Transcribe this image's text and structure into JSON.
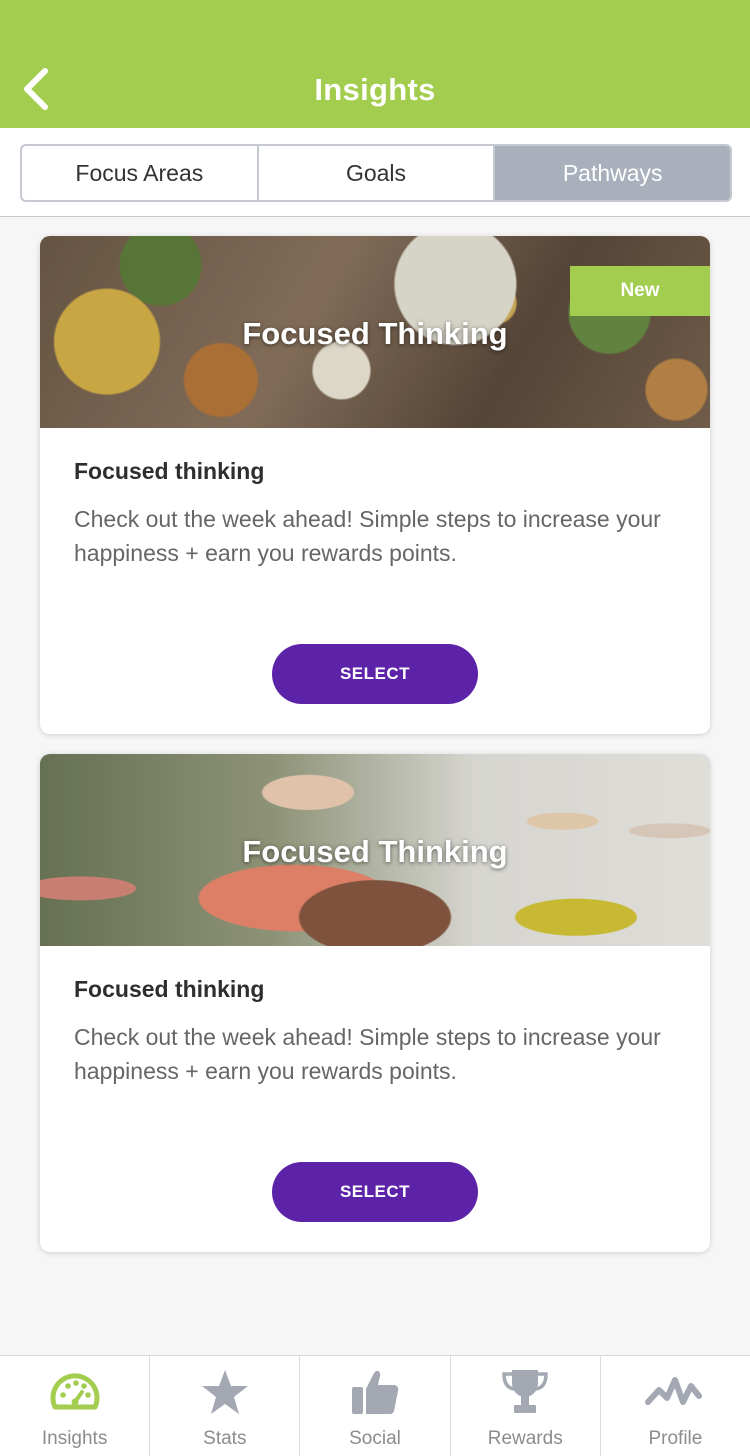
{
  "header": {
    "title": "Insights",
    "back_icon": "chevron-left-icon"
  },
  "tabs": {
    "items": [
      {
        "label": "Focus Areas"
      },
      {
        "label": "Goals"
      },
      {
        "label": "Pathways"
      }
    ],
    "active": "Pathways"
  },
  "cards": [
    {
      "image_caption": "Focused Thinking",
      "badge": "New",
      "title": "Focused thinking",
      "description": "Check out the week ahead! Simple steps to increase your happiness + earn you rewards points.",
      "button": "SELECT"
    },
    {
      "image_caption": "Focused Thinking",
      "title": "Focused thinking",
      "description": "Check out the week ahead! Simple steps to increase your happiness + earn you rewards points.",
      "button": "SELECT"
    }
  ],
  "bottom_nav": {
    "items": [
      {
        "label": "Insights",
        "icon": "gauge-icon",
        "active": true
      },
      {
        "label": "Stats",
        "icon": "star-icon"
      },
      {
        "label": "Social",
        "icon": "thumbs-up-icon"
      },
      {
        "label": "Rewards",
        "icon": "trophy-icon"
      },
      {
        "label": "Profile",
        "icon": "activity-icon"
      }
    ]
  },
  "colors": {
    "header_green": "#a3cd4e",
    "button_purple": "#5c22a8",
    "active_tab": "#a9b0bb",
    "nav_active": "#a3cd4e",
    "nav_inactive": "#a3a8b2"
  }
}
